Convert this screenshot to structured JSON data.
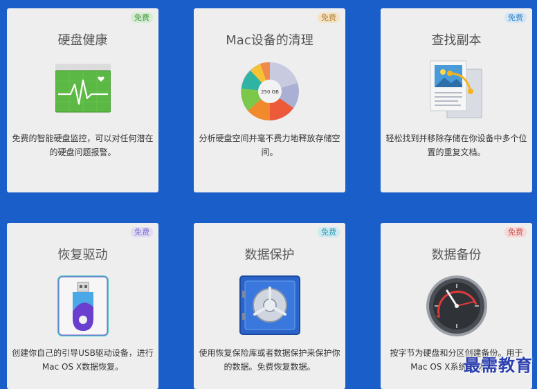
{
  "cards": [
    {
      "title": "硬盘健康",
      "badge": "免费",
      "description": "免费的智能硬盘监控，可以对任何潜在的硬盘问题报警。",
      "icon": "disk-health-icon"
    },
    {
      "title": "Mac设备的清理",
      "badge": "免费",
      "description": "分析硬盘空间并毫不费力地释放存储空间。",
      "icon": "disk-cleanup-pie-icon",
      "icon_label": "250 GB"
    },
    {
      "title": "查找副本",
      "badge": "免费",
      "description": "轻松找到并移除存储在你设备中多个位置的重复文档。",
      "icon": "duplicate-finder-icon"
    },
    {
      "title": "恢复驱动",
      "badge": "免费",
      "description": "创建你自己的引导USB驱动设备，进行Mac OS X数据恢复。",
      "icon": "usb-drive-icon"
    },
    {
      "title": "数据保护",
      "badge": "免费",
      "description": "使用恢复保险库或者数据保护来保护你的数据。免费恢复数据。",
      "icon": "vault-safe-icon"
    },
    {
      "title": "数据备份",
      "badge": "免费",
      "description": "按字节为硬盘和分区创建备份。用于Mac OS X系统... 恢复。",
      "icon": "backup-clock-icon"
    }
  ],
  "watermark": "最需教育",
  "colors": {
    "background": "#1a5fc9",
    "card": "#eeeeee"
  }
}
